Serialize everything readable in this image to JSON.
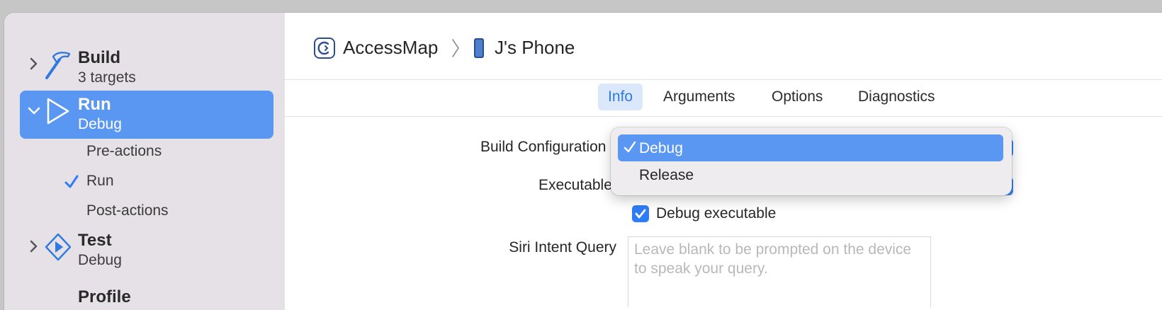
{
  "sidebar": {
    "schemes": [
      {
        "title": "Build",
        "subtitle": "3 targets",
        "icon": "hammer-icon"
      },
      {
        "title": "Run",
        "subtitle": "Debug",
        "icon": "play-outline-icon"
      },
      {
        "title": "Test",
        "subtitle": "Debug",
        "icon": "test-diamond-icon"
      }
    ],
    "run_actions": [
      "Pre-actions",
      "Run",
      "Post-actions"
    ],
    "partial_item": "Profile"
  },
  "breadcrumb": {
    "app": "AccessMap",
    "device": "J's Phone"
  },
  "tabs": [
    "Info",
    "Arguments",
    "Options",
    "Diagnostics"
  ],
  "form": {
    "build_configuration_label": "Build Configuration",
    "executable_label": "Executable",
    "debug_executable_label": "Debug executable",
    "siri_label": "Siri Intent Query",
    "siri_placeholder": "Leave blank to be prompted on the device to speak your query."
  },
  "popup": {
    "options": [
      "Debug",
      "Release"
    ],
    "selected": "Debug"
  },
  "colors": {
    "accent": "#2e7cf6",
    "selection": "#5a97f2",
    "sidebar_bg": "#e6e1e6"
  }
}
